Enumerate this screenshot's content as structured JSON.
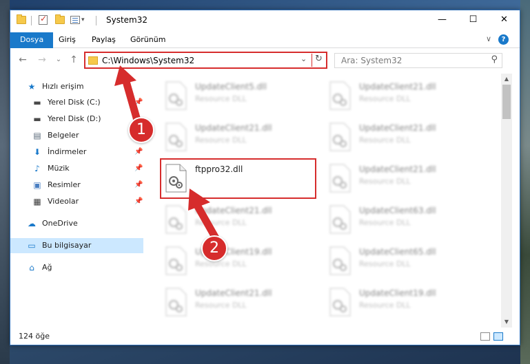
{
  "window": {
    "title": "System32",
    "min_glyph": "—",
    "max_glyph": "☐",
    "close_glyph": "✕"
  },
  "ribbon": {
    "tabs": [
      {
        "label": "Dosya"
      },
      {
        "label": "Giriş"
      },
      {
        "label": "Paylaş"
      },
      {
        "label": "Görünüm"
      }
    ],
    "collapse_glyph": "∨",
    "help_glyph": "?"
  },
  "nav": {
    "back_glyph": "←",
    "forward_glyph": "→",
    "recent_glyph": "⌄",
    "up_glyph": "↑",
    "address": "C:\\Windows\\System32",
    "dropdown_glyph": "⌄",
    "refresh_glyph": "↻",
    "search_placeholder": "Ara: System32",
    "search_glyph": "⚲"
  },
  "sidebar": {
    "items": [
      {
        "label": "Hızlı erişim",
        "icon": "star-icon",
        "glyph": "★",
        "color": "#1979ca"
      },
      {
        "label": "Yerel Disk (C:)",
        "icon": "drive-icon",
        "glyph": "▬",
        "color": "#4a4a4a"
      },
      {
        "label": "Yerel Disk (D:)",
        "icon": "drive-icon",
        "glyph": "▬",
        "color": "#4a4a4a"
      },
      {
        "label": "Belgeler",
        "icon": "documents-icon",
        "glyph": "▤",
        "color": "#5a6a7a"
      },
      {
        "label": "İndirmeler",
        "icon": "downloads-icon",
        "glyph": "⬇",
        "color": "#1979ca"
      },
      {
        "label": "Müzik",
        "icon": "music-icon",
        "glyph": "♪",
        "color": "#1979ca"
      },
      {
        "label": "Resimler",
        "icon": "pictures-icon",
        "glyph": "▣",
        "color": "#4a7fc1"
      },
      {
        "label": "Videolar",
        "icon": "videos-icon",
        "glyph": "▦",
        "color": "#3a3a3a"
      },
      {
        "label": "OneDrive",
        "icon": "cloud-icon",
        "glyph": "☁",
        "color": "#1979ca"
      },
      {
        "label": "Bu bilgisayar",
        "icon": "computer-icon",
        "glyph": "▭",
        "color": "#1979ca"
      },
      {
        "label": "Ağ",
        "icon": "network-icon",
        "glyph": "⌂",
        "color": "#1979ca"
      }
    ],
    "pin_glyph": "📌"
  },
  "files": {
    "items": [
      {
        "name": "UpdateClient5.dll",
        "type": "Resource DLL"
      },
      {
        "name": "UpdateClient21.dll",
        "type": "Resource DLL"
      },
      {
        "name": "UpdateClient21.dll",
        "type": "Resource DLL"
      },
      {
        "name": "UpdateClient21.dll",
        "type": "Resource DLL"
      },
      {
        "name": "ftppro32.dll",
        "type": ""
      },
      {
        "name": "UpdateClient21.dll",
        "type": "Resource DLL"
      },
      {
        "name": "UpdateClient21.dll",
        "type": "Resource DLL"
      },
      {
        "name": "UpdateClient63.dll",
        "type": "Resource DLL"
      },
      {
        "name": "UpdateClient19.dll",
        "type": "Resource DLL"
      },
      {
        "name": "UpdateClient65.dll",
        "type": "Resource DLL"
      },
      {
        "name": "UpdateClient21.dll",
        "type": "Resource DLL"
      },
      {
        "name": "UpdateClient19.dll",
        "type": "Resource DLL"
      }
    ]
  },
  "status": {
    "count": "124 öğe"
  },
  "annotations": {
    "step1": "1",
    "step2": "2",
    "color": "#d62c2c"
  }
}
